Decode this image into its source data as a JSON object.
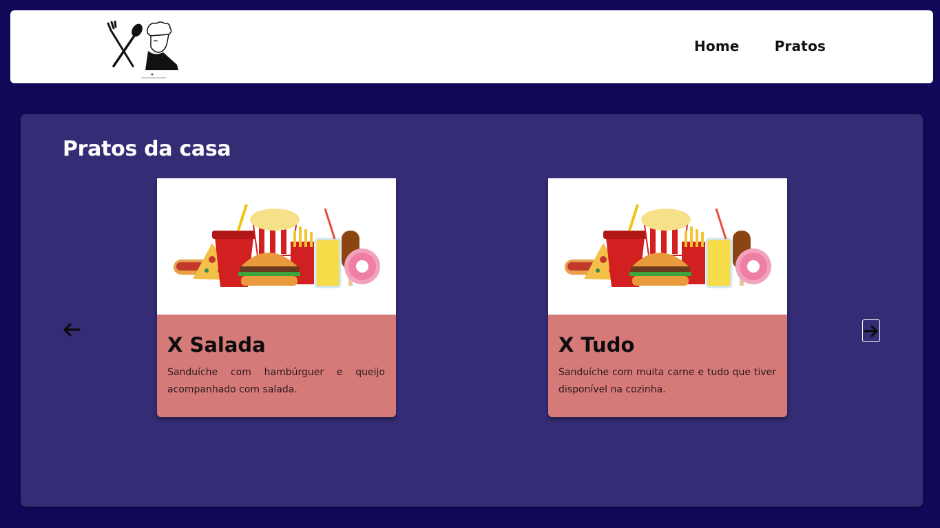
{
  "header": {
    "logo_icon": "chef-logo-icon",
    "nav": [
      {
        "label": "Home"
      },
      {
        "label": "Pratos"
      }
    ]
  },
  "main": {
    "title": "Pratos da casa",
    "prev_icon": "arrow-left-icon",
    "next_icon": "arrow-right-icon",
    "dishes": [
      {
        "image_icon": "fast-food-illustration",
        "name": "X Salada",
        "description": "Sanduíche com hambúrguer e queijo acompanhado com salada."
      },
      {
        "image_icon": "fast-food-illustration",
        "name": "X Tudo",
        "description": "Sanduíche com muita carne e tudo que tiver disponível na cozinha."
      }
    ]
  },
  "colors": {
    "background": "#11085a",
    "panel": "#342c74",
    "card_body": "#d67979",
    "header": "#ffffff"
  }
}
